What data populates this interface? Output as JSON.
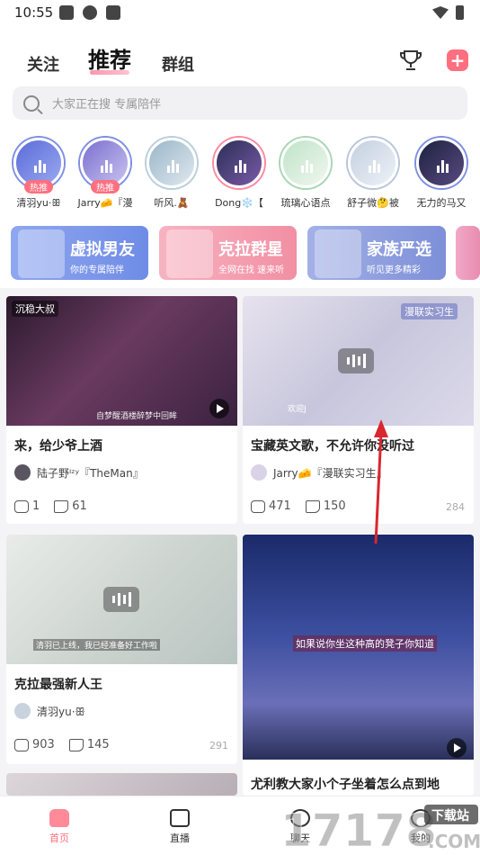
{
  "status": {
    "time": "10:55"
  },
  "header": {
    "tabs": [
      "关注",
      "推荐",
      "群组"
    ],
    "active_tab": "推荐",
    "accent": "#ff6f7f"
  },
  "search": {
    "placeholder": "大家正在搜 专属陪伴"
  },
  "avatars": [
    {
      "name": "清羽yu·ꕥ",
      "badge": "热推"
    },
    {
      "name": "Jarry🧀『漫",
      "badge": "热推"
    },
    {
      "name": "听风.🧸",
      "badge": ""
    },
    {
      "name": "Dong❄️【",
      "badge": ""
    },
    {
      "name": "琉璃心语点",
      "badge": ""
    },
    {
      "name": "舒子微🤔被",
      "badge": ""
    },
    {
      "name": "无力的马又",
      "badge": ""
    }
  ],
  "banners": [
    {
      "title": "虚拟男友",
      "subtitle": "你的专属陪伴",
      "color": "#6f8ce6"
    },
    {
      "title": "克拉群星",
      "subtitle": "全网在找 速来听",
      "color": "#f28fa3"
    },
    {
      "title": "家族严选",
      "subtitle": "听见更多精彩",
      "color": "#7d8fd8"
    }
  ],
  "cards": [
    {
      "tag": "沉稳大叔",
      "caption": "自梦醒酒楼醉梦中回眸",
      "title": "来，给少爷上酒",
      "author": "陆子野ᴵᶻʸ『TheMan』",
      "comments": "1",
      "likes": "61",
      "heat": ""
    },
    {
      "tag": "漫联实习生",
      "caption": "欢迎J",
      "title": "宝藏英文歌，不允许你没听过",
      "author": "Jarry🧀『漫联实习生』",
      "comments": "471",
      "likes": "150",
      "heat": "284"
    },
    {
      "tag": "",
      "caption": "清羽已上线，我已经准备好工作啦",
      "title": "克拉最强新人王",
      "author": "清羽yu·ꕥ",
      "comments": "903",
      "likes": "145",
      "heat": "291"
    },
    {
      "tag": "",
      "caption": "如果说你坐这种高的凳子你知道",
      "title": "尤利教大家小个子坐着怎么点到地",
      "author": "",
      "comments": "",
      "likes": "",
      "heat": ""
    }
  ],
  "bottom_nav": [
    {
      "label": "首页",
      "icon": "home-icon"
    },
    {
      "label": "直播",
      "icon": "video-icon"
    },
    {
      "label": "聊天",
      "icon": "chat-icon"
    },
    {
      "label": "我的",
      "icon": "profile-icon"
    }
  ],
  "watermark": {
    "text": "17178",
    "sub": "下载站",
    "tail": ".COM"
  },
  "annotation_color": "#d9262f"
}
